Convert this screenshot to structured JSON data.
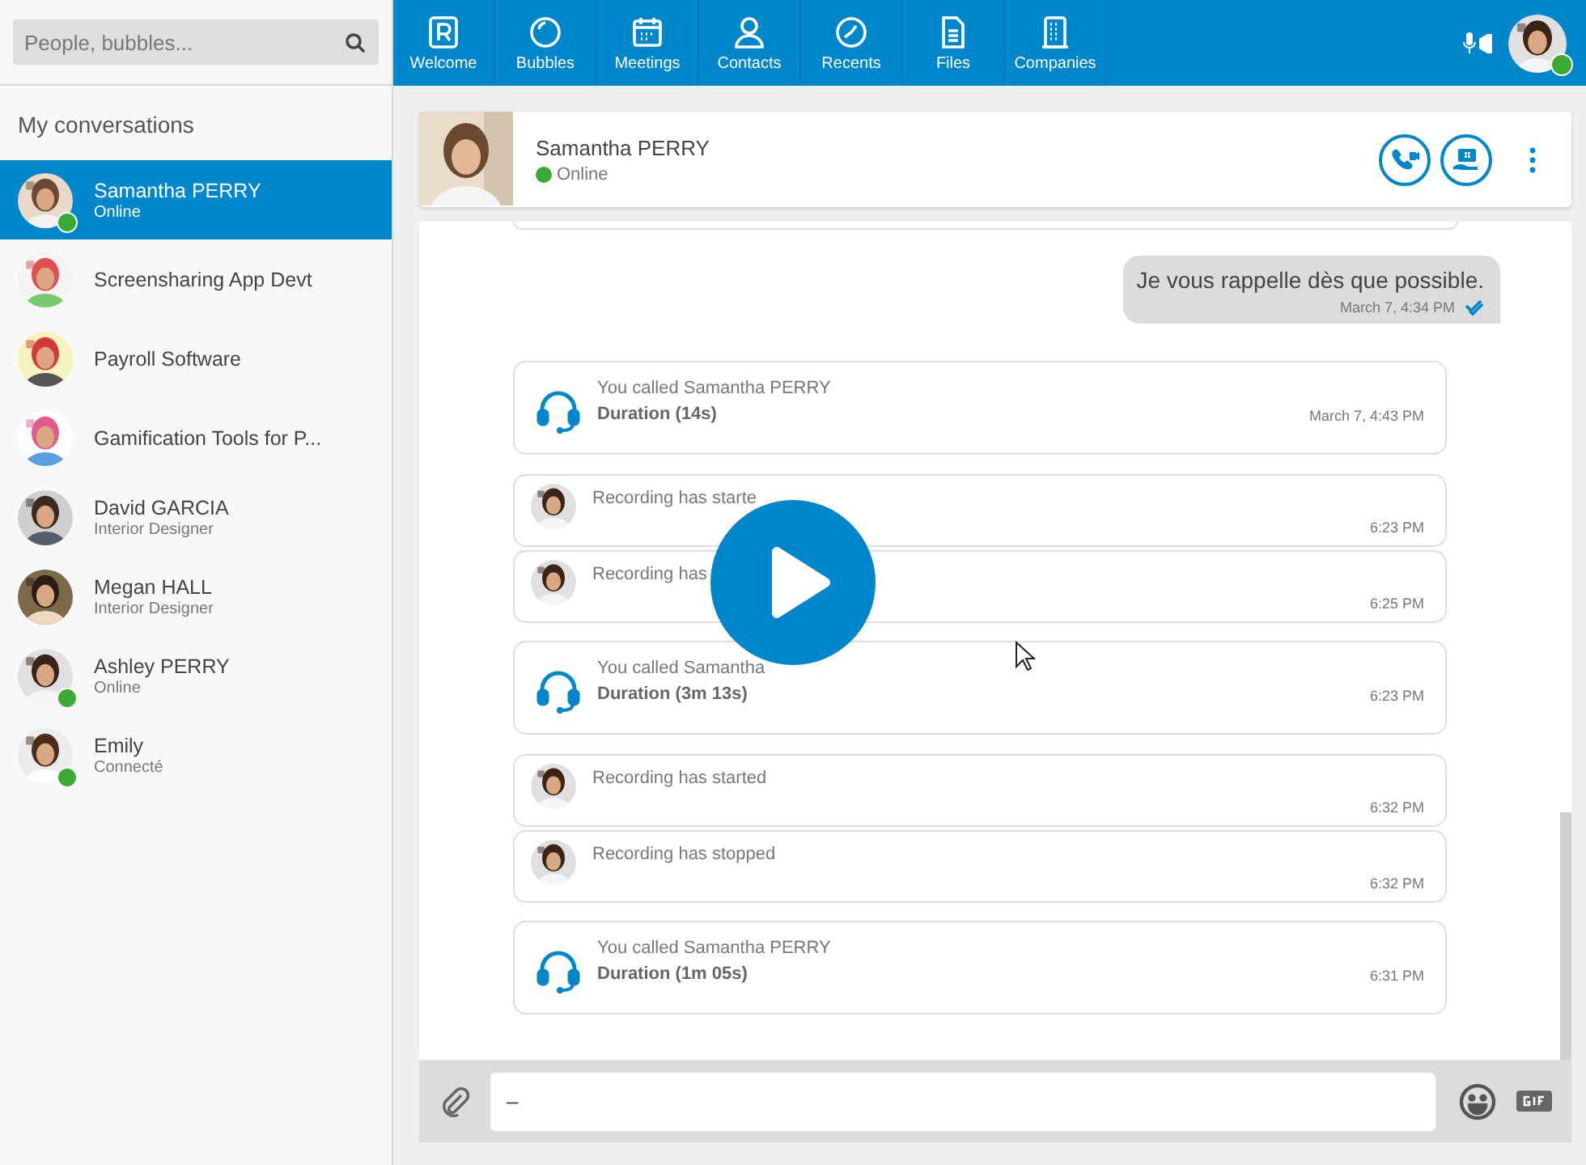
{
  "search": {
    "placeholder": "People, bubbles..."
  },
  "nav": [
    {
      "label": "Welcome",
      "selected": false
    },
    {
      "label": "Bubbles",
      "selected": false
    },
    {
      "label": "Meetings",
      "selected": false
    },
    {
      "label": "Contacts",
      "selected": false
    },
    {
      "label": "Recents",
      "selected": false
    },
    {
      "label": "Files",
      "selected": false
    },
    {
      "label": "Companies",
      "selected": false
    }
  ],
  "user": {
    "online": true
  },
  "sidebar": {
    "title": "My conversations",
    "items": [
      {
        "kind": "person",
        "name": "Samantha PERRY",
        "subtitle": "Online",
        "online": true,
        "selected": true
      },
      {
        "kind": "bubble",
        "name": "Screensharing App Devt",
        "online": false,
        "selected": false
      },
      {
        "kind": "bubble",
        "name": "Payroll Software",
        "online": false,
        "selected": false
      },
      {
        "kind": "bubble",
        "name": "Gamification Tools for P...",
        "online": false,
        "selected": false
      },
      {
        "kind": "person",
        "name": "David GARCIA",
        "subtitle": "Interior Designer",
        "online": false,
        "selected": false
      },
      {
        "kind": "person",
        "name": "Megan HALL",
        "subtitle": "Interior Designer",
        "online": false,
        "selected": false
      },
      {
        "kind": "person",
        "name": "Ashley PERRY",
        "subtitle": "Online",
        "online": true,
        "selected": false
      },
      {
        "kind": "person",
        "name": "Emily",
        "subtitle": "Connecté",
        "online": true,
        "selected": false
      }
    ]
  },
  "contact": {
    "name": "Samantha PERRY",
    "status": "Online",
    "online": true
  },
  "messages": [
    {
      "kind": "message",
      "text": "Je vous rappelle dès que possible.",
      "time": "March 7, 4:34 PM",
      "read": true
    },
    {
      "kind": "call",
      "title": "You called Samantha PERRY",
      "duration": "Duration (14s)",
      "time": "March 7, 4:43 PM"
    },
    {
      "kind": "recording",
      "text": "Recording has starte",
      "time": "6:23 PM"
    },
    {
      "kind": "recording",
      "text": "Recording has",
      "time": "6:25 PM"
    },
    {
      "kind": "call",
      "title": "You called Samantha",
      "duration": "Duration (3m 13s)",
      "time": "6:23 PM"
    },
    {
      "kind": "recording",
      "text": "Recording has started",
      "time": "6:32 PM"
    },
    {
      "kind": "recording",
      "text": "Recording has stopped",
      "time": "6:32 PM"
    },
    {
      "kind": "call",
      "title": "You called Samantha PERRY",
      "duration": "Duration (1m 05s)",
      "time": "6:31 PM"
    }
  ],
  "composer": {
    "value": "–"
  }
}
